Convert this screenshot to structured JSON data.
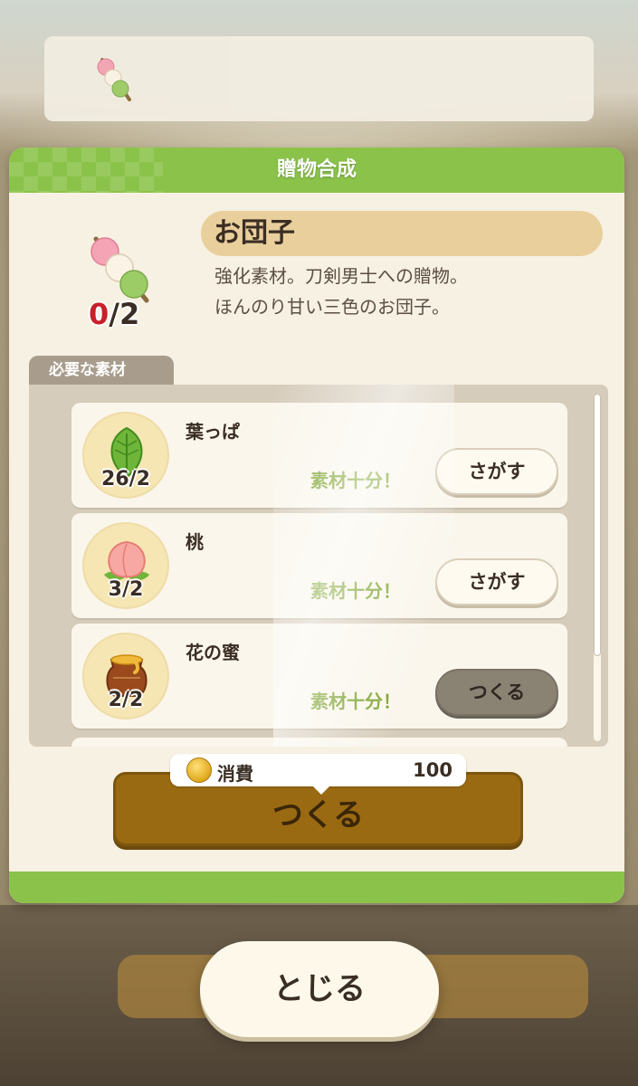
{
  "top_banner": {
    "icon": "dango-icon"
  },
  "dialog": {
    "title": "贈物合成",
    "item": {
      "icon": "dango-icon",
      "name": "お団子",
      "count_have": "0",
      "count_need": "/2",
      "description_line1": "強化素材。刀剣男士への贈物。",
      "description_line2": "ほんのり甘い三色のお団子。"
    },
    "materials_tab": "必要な素材",
    "materials": [
      {
        "icon": "leaf-icon",
        "name": "葉っぱ",
        "count": "26/2",
        "status": "素材十分！",
        "button": "さがす"
      },
      {
        "icon": "peach-icon",
        "name": "桃",
        "count": "3/2",
        "status": "素材十分！",
        "button": "さがす"
      },
      {
        "icon": "honey-pot-icon",
        "name": "花の蜜",
        "count": "2/2",
        "status": "素材十分！",
        "button": "つくる"
      }
    ],
    "cost": {
      "icon": "coin-icon",
      "label": "消費",
      "value": "100"
    },
    "make_button": "つくる"
  },
  "close_button": "とじる",
  "colors": {
    "accent_green": "#8bc34a",
    "status_green": "#7aa22c",
    "make_brown": "#9a6a12",
    "count_red": "#c8202a"
  }
}
